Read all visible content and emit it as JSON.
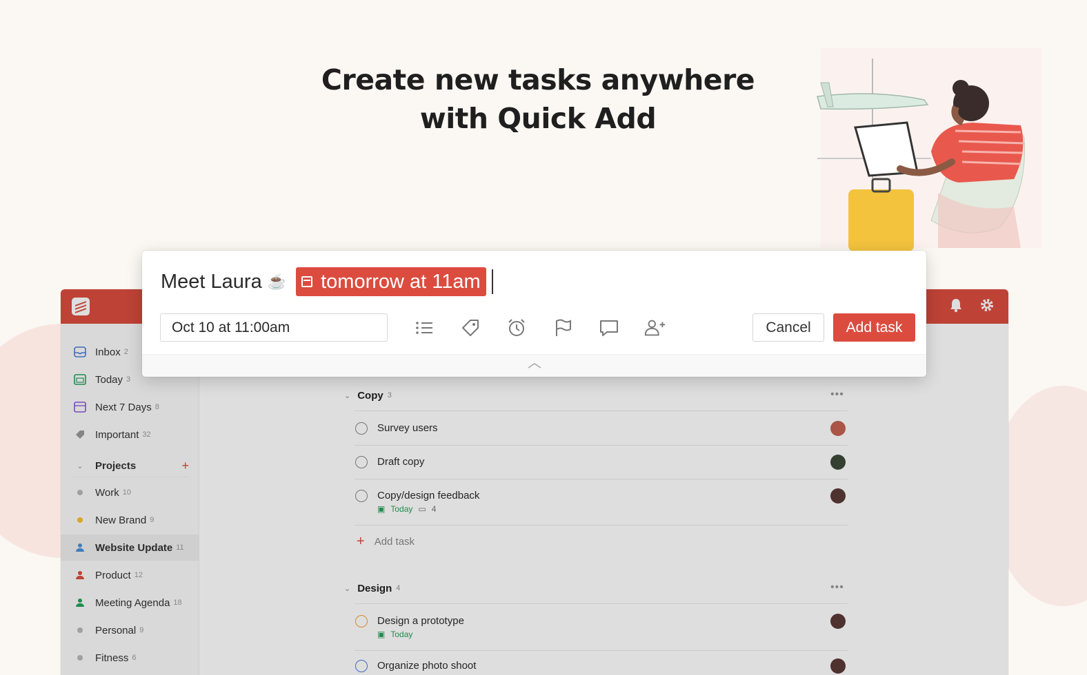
{
  "headline": {
    "line1": "Create new tasks anywhere",
    "line2": "with Quick Add"
  },
  "colors": {
    "brand": "#db4c3f",
    "today": "#25a05a"
  },
  "quick_add": {
    "task_text": "Meet Laura",
    "emoji": "☕",
    "date_chip": "tomorrow at 11am",
    "date_field": "Oct 10 at 11:00am",
    "tools": [
      "list-icon",
      "label-icon",
      "alarm-icon",
      "flag-icon",
      "comment-icon",
      "add-person-icon"
    ],
    "cancel_label": "Cancel",
    "add_label": "Add task",
    "footer_icon": "chevron-up-icon"
  },
  "topbar": {
    "icons": [
      "bell-icon",
      "gear-icon"
    ]
  },
  "sidebar": {
    "items": [
      {
        "label": "Inbox",
        "count": "2",
        "icon": "inbox-icon"
      },
      {
        "label": "Today",
        "count": "3",
        "icon": "calendar-today-icon"
      },
      {
        "label": "Next 7 Days",
        "count": "8",
        "icon": "calendar-week-icon"
      },
      {
        "label": "Important",
        "count": "32",
        "icon": "label-icon"
      }
    ],
    "projects_label": "Projects",
    "projects": [
      {
        "label": "Work",
        "count": "10",
        "color": "#b8b8b8",
        "kind": "dot"
      },
      {
        "label": "New Brand",
        "count": "9",
        "color": "#f2c12e",
        "kind": "dot"
      },
      {
        "label": "Website Update",
        "count": "11",
        "color": "#4a90d9",
        "kind": "person"
      },
      {
        "label": "Product",
        "count": "12",
        "color": "#db4c3f",
        "kind": "person"
      },
      {
        "label": "Meeting Agenda",
        "count": "18",
        "color": "#25a05a",
        "kind": "person"
      },
      {
        "label": "Personal",
        "count": "9",
        "color": "#b8b8b8",
        "kind": "dot"
      },
      {
        "label": "Fitness",
        "count": "6",
        "color": "#b8b8b8",
        "kind": "dot"
      }
    ]
  },
  "sections": [
    {
      "name": "Copy",
      "count": "3",
      "tasks": [
        {
          "title": "Survey users"
        },
        {
          "title": "Draft copy"
        },
        {
          "title": "Copy/design feedback",
          "due": "Today",
          "comments": "4"
        }
      ],
      "add_label": "Add task"
    },
    {
      "name": "Design",
      "count": "4",
      "tasks": [
        {
          "title": "Design a prototype",
          "due": "Today"
        },
        {
          "title": "Organize photo shoot"
        }
      ]
    }
  ]
}
